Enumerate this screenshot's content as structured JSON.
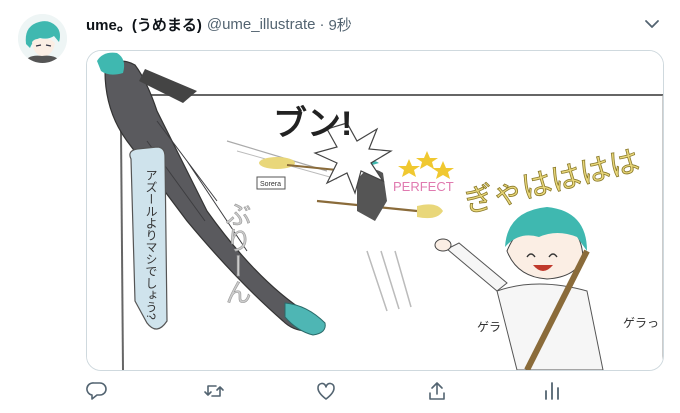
{
  "tweet": {
    "display_name": "ume。(うめまる)",
    "handle": "@ume_illustrate",
    "separator": "·",
    "timestamp": "9秒"
  },
  "artwork": {
    "sfx_top": "ブン!",
    "sign_text": "Sorera",
    "perfect_text": "PERFECT",
    "speech_bubble": "アズールよりマシでしょう?",
    "sfx_swing": "ぶりーん",
    "sfx_laugh": "ぎゃはははは",
    "sfx_gura_left": "ゲラ",
    "sfx_gura_right": "ゲラっ"
  },
  "actions": [
    "reply-icon",
    "retweet-icon",
    "like-icon",
    "share-icon",
    "analytics-icon"
  ],
  "colors": {
    "teal_hair": "#3fb8b0",
    "yellow_sfx": "#e9d77a",
    "pink_text": "#e07ab0",
    "bubble_blue": "#cfe3ec"
  }
}
